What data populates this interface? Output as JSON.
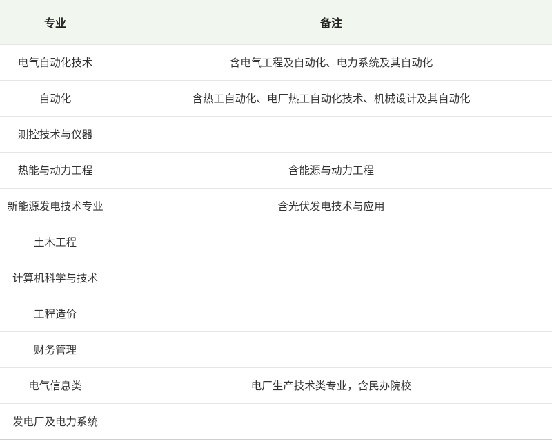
{
  "table": {
    "headers": {
      "major": "专业",
      "note": "备注"
    },
    "rows": [
      {
        "major": "电气自动化技术",
        "note": "含电气工程及自动化、电力系统及其自动化"
      },
      {
        "major": "自动化",
        "note": "含热工自动化、电厂热工自动化技术、机械设计及其自动化"
      },
      {
        "major": "测控技术与仪器",
        "note": ""
      },
      {
        "major": "热能与动力工程",
        "note": "含能源与动力工程"
      },
      {
        "major": "新能源发电技术专业",
        "note": "含光伏发电技术与应用"
      },
      {
        "major": "土木工程",
        "note": ""
      },
      {
        "major": "计算机科学与技术",
        "note": ""
      },
      {
        "major": "工程造价",
        "note": ""
      },
      {
        "major": "财务管理",
        "note": ""
      },
      {
        "major": "电气信息类",
        "note": "电厂生产技术类专业，含民办院校"
      },
      {
        "major": "发电厂及电力系统",
        "note": ""
      }
    ]
  }
}
